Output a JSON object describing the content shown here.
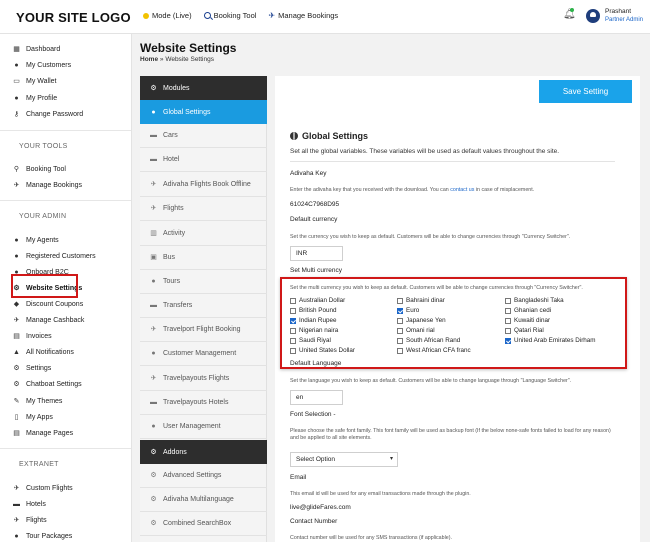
{
  "header": {
    "logo": "YOUR SITE LOGO",
    "nav": [
      {
        "label": "Mode (Live)",
        "icon": "status-dot-icon"
      },
      {
        "label": "Booking Tool",
        "icon": "search-icon"
      },
      {
        "label": "Manage Bookings",
        "icon": "plane-icon"
      }
    ],
    "user": {
      "name": "Prashant",
      "role": "Partner Admin"
    }
  },
  "sidebar": {
    "main": [
      {
        "label": "Dashboard",
        "icon": "dashboard-icon"
      },
      {
        "label": "My Customers",
        "icon": "user-icon"
      },
      {
        "label": "My Wallet",
        "icon": "wallet-icon"
      },
      {
        "label": "My Profile",
        "icon": "user-icon"
      },
      {
        "label": "Change Password",
        "icon": "key-icon"
      }
    ],
    "tools_heading": "YOUR TOOLS",
    "tools": [
      {
        "label": "Booking Tool",
        "icon": "search-icon"
      },
      {
        "label": "Manage Bookings",
        "icon": "plane-icon"
      }
    ],
    "admin_heading": "YOUR ADMIN",
    "admin": [
      {
        "label": "My Agents",
        "icon": "users-icon"
      },
      {
        "label": "Registered Customers",
        "icon": "users-icon"
      },
      {
        "label": "Onboard B2C",
        "icon": "users-icon"
      },
      {
        "label": "Website Settings",
        "icon": "gears-icon"
      },
      {
        "label": "Discount Coupons",
        "icon": "tag-icon"
      },
      {
        "label": "Manage Cashback",
        "icon": "plane-icon"
      },
      {
        "label": "Invoices",
        "icon": "invoice-icon"
      },
      {
        "label": "All Notifications",
        "icon": "bell-icon"
      },
      {
        "label": "Settings",
        "icon": "gear-icon"
      },
      {
        "label": "Chatboat Settings",
        "icon": "gears-icon"
      },
      {
        "label": "My Themes",
        "icon": "brush-icon"
      },
      {
        "label": "My Apps",
        "icon": "mobile-icon"
      },
      {
        "label": "Manage Pages",
        "icon": "page-icon"
      }
    ],
    "extranet_heading": "EXTRANET",
    "extranet": [
      {
        "label": "Custom Flights",
        "icon": "plane-icon"
      },
      {
        "label": "Hotels",
        "icon": "bed-icon"
      },
      {
        "label": "Flights",
        "icon": "plane-icon"
      },
      {
        "label": "Tour Packages",
        "icon": "globe-icon"
      }
    ]
  },
  "page": {
    "title": "Website Settings",
    "breadcrumb_home": "Home",
    "breadcrumb_sep": "»",
    "breadcrumb_current": "Website Settings"
  },
  "settings_menu": {
    "modules_label": "Modules",
    "items": [
      "Global Settings",
      "Cars",
      "Hotel",
      "Adivaha Flights Book Offline",
      "Flights",
      "Activity",
      "Bus",
      "Tours",
      "Transfers",
      "Travelport Flight Booking",
      "Customer Management",
      "Travelpayouts Flights",
      "Travelpayouts Hotels",
      "User Management"
    ],
    "addons_label": "Addons",
    "addons": [
      "Advanced Settings",
      "Adivaha Multilanguage",
      "Combined SearchBox"
    ]
  },
  "form": {
    "save_label": "Save Setting",
    "section_title": "Global Settings",
    "section_desc": "Set all the global variables. These variables will be used as default values throughout the site.",
    "adivaha_key_label": "Adivaha Key",
    "adivaha_key_help_pre": "Enter the adivaha key that you received with the download. You can",
    "adivaha_key_help_link": "contact us",
    "adivaha_key_help_post": "in case of misplacement.",
    "adivaha_key_value": "61024C7968D95",
    "default_currency_label": "Default currency",
    "default_currency_help": "Set the currency you wish to keep as default. Customers will be able to change currencies through \"Currency Switcher\".",
    "default_currency_value": "INR",
    "multi_currency_label": "Set Multi currency",
    "multi_currency_help": "Set the multi currency you wish to keep as default. Customers will be able to change currencies through \"Currency Switcher\".",
    "currencies": [
      {
        "label": "Australian Dollar",
        "checked": false
      },
      {
        "label": "Bahraini dinar",
        "checked": false
      },
      {
        "label": "Bangladeshi Taka",
        "checked": false
      },
      {
        "label": "British Pound",
        "checked": false
      },
      {
        "label": "Euro",
        "checked": true
      },
      {
        "label": "Ghanian cedi",
        "checked": false
      },
      {
        "label": "Indian Rupee",
        "checked": true
      },
      {
        "label": "Japanese Yen",
        "checked": false
      },
      {
        "label": "Kuwaiti dinar",
        "checked": false
      },
      {
        "label": "Nigerian naira",
        "checked": false
      },
      {
        "label": "Omani rial",
        "checked": false
      },
      {
        "label": "Qatari Rial",
        "checked": false
      },
      {
        "label": "Saudi Riyal",
        "checked": false
      },
      {
        "label": "South African Rand",
        "checked": false
      },
      {
        "label": "United Arab Emirates Dirham",
        "checked": true
      },
      {
        "label": "United States Dollar",
        "checked": false
      },
      {
        "label": "West African CFA franc",
        "checked": false
      }
    ],
    "default_language_label": "Default Language",
    "default_language_help": "Set the language you wish to keep as default. Customers will be able to change language through \"Language Switcher\".",
    "default_language_value": "en",
    "font_label": "Font Selection -",
    "font_help": "Please choose the safe font family. This font family will be used as backup font (If the below none-safe fonts failed to load for any reason) and be applied to all site elements.",
    "font_select_value": "Select Option",
    "email_label": "Email",
    "email_help": "This email id will be used for any email transactions made through the plugin.",
    "email_value": "live@glideFares.com",
    "contact_label": "Contact Number",
    "contact_help": "Contact number will be used for any SMS transactions (if applicable)."
  }
}
